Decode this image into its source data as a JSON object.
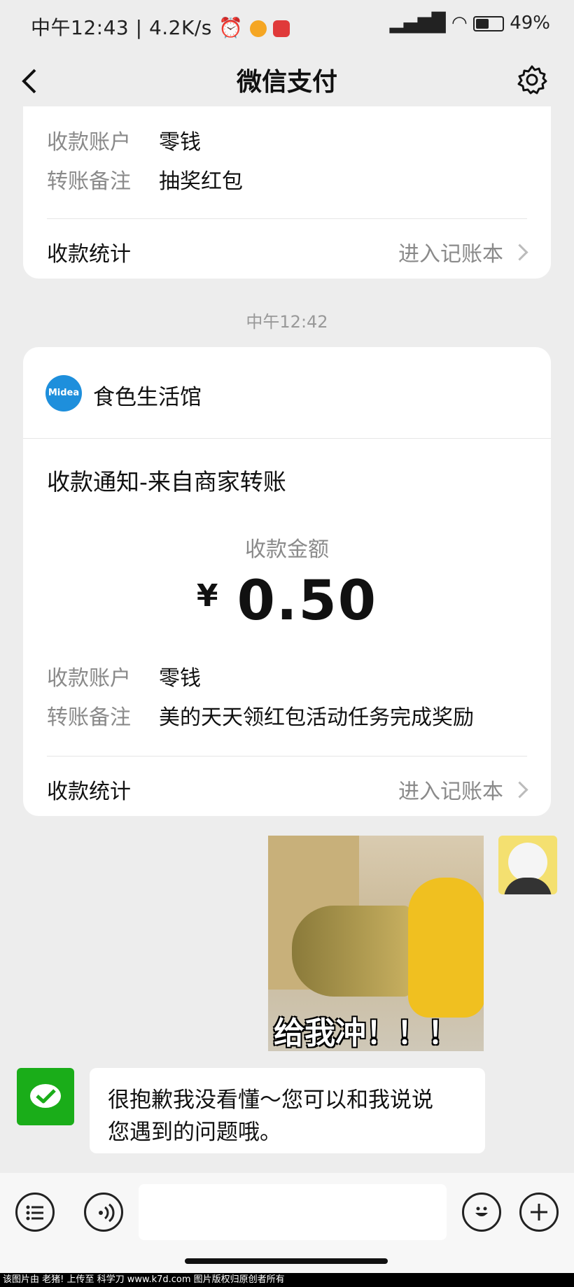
{
  "status_bar": {
    "time": "中午12:43",
    "speed": "4.2K/s",
    "battery": "49%"
  },
  "nav": {
    "title": "微信支付"
  },
  "card1": {
    "account_label": "收款账户",
    "account_value": "零钱",
    "remark_label": "转账备注",
    "remark_value": "抽奖红包",
    "stats_label": "收款统计",
    "stats_link": "进入记账本"
  },
  "timestamp": "中午12:42",
  "card2": {
    "merchant": "食色生活馆",
    "logo_text": "Midea",
    "title": "收款通知-来自商家转账",
    "amount_label": "收款金额",
    "currency": "¥",
    "amount": "0.50",
    "account_label": "收款账户",
    "account_value": "零钱",
    "remark_label": "转账备注",
    "remark_value": "美的天天领红包活动任务完成奖励",
    "stats_label": "收款统计",
    "stats_link": "进入记账本"
  },
  "sticker": {
    "caption": "给我冲！！！"
  },
  "reply": {
    "line1": "很抱歉我没看懂～您可以和我说说",
    "line2": "您遇到的问题哦。"
  },
  "footer": {
    "text": "该图片由 老猪! 上传至 科学刀 www.k7d.com 图片版权归原创者所有"
  }
}
